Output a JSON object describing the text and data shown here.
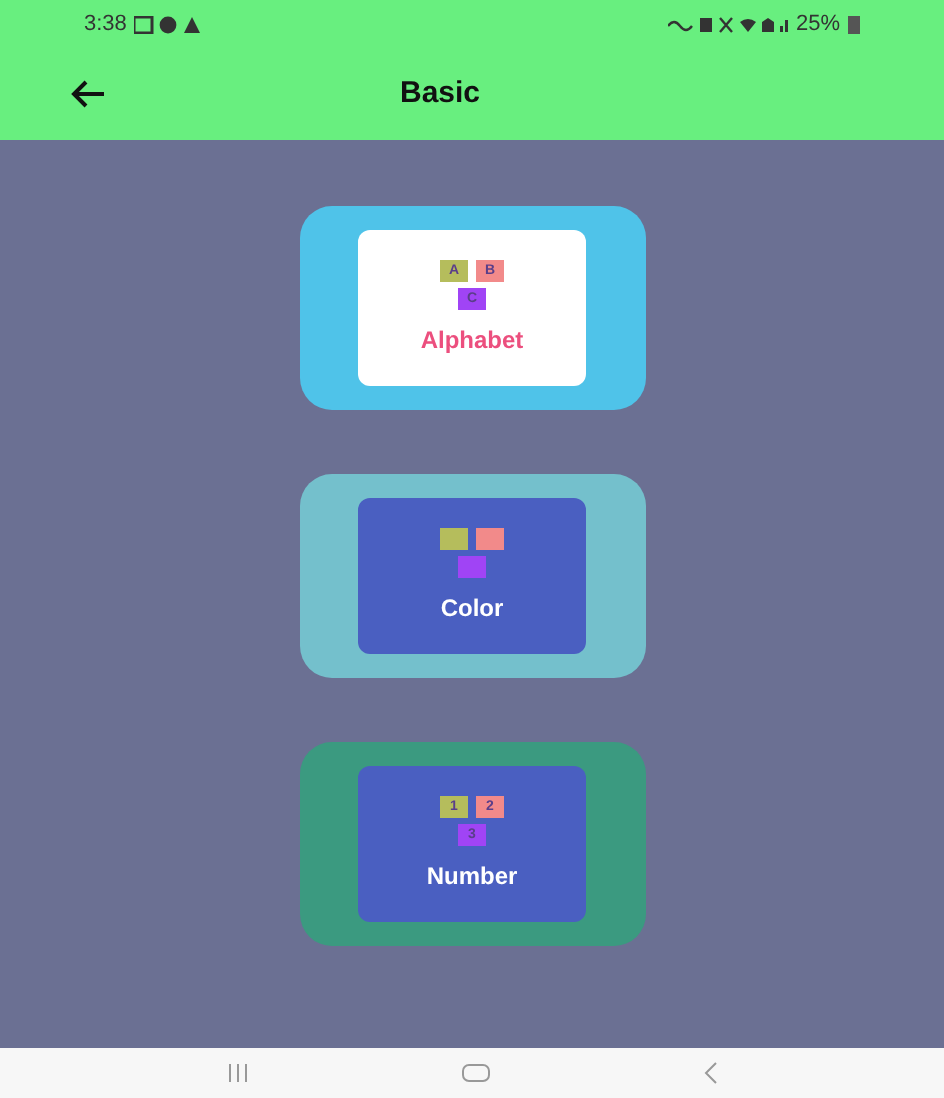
{
  "status_bar": {
    "time": "3:38",
    "battery": "25%"
  },
  "app_bar": {
    "title": "Basic"
  },
  "cards": [
    {
      "label": "Alphabet",
      "color": "#4fc3e9",
      "kind": "light",
      "tiles": [
        {
          "text": "A",
          "color": "#b5bd5c"
        },
        {
          "text": "B",
          "color": "#f28a8a"
        },
        {
          "text": "C",
          "color": "#a044f5"
        }
      ]
    },
    {
      "label": "Color",
      "color": "#74c0cc",
      "kind": "dark",
      "tiles": [
        {
          "color": "#b5bd5c"
        },
        {
          "color": "#f28a8a"
        },
        {
          "color": "#a044f5"
        }
      ]
    },
    {
      "label": "Number",
      "color": "#3b9a80",
      "kind": "dark",
      "tiles": [
        {
          "text": "1",
          "color": "#b5bd5c"
        },
        {
          "text": "2",
          "color": "#f28a8a"
        },
        {
          "text": "3",
          "color": "#a044f5"
        }
      ]
    }
  ]
}
